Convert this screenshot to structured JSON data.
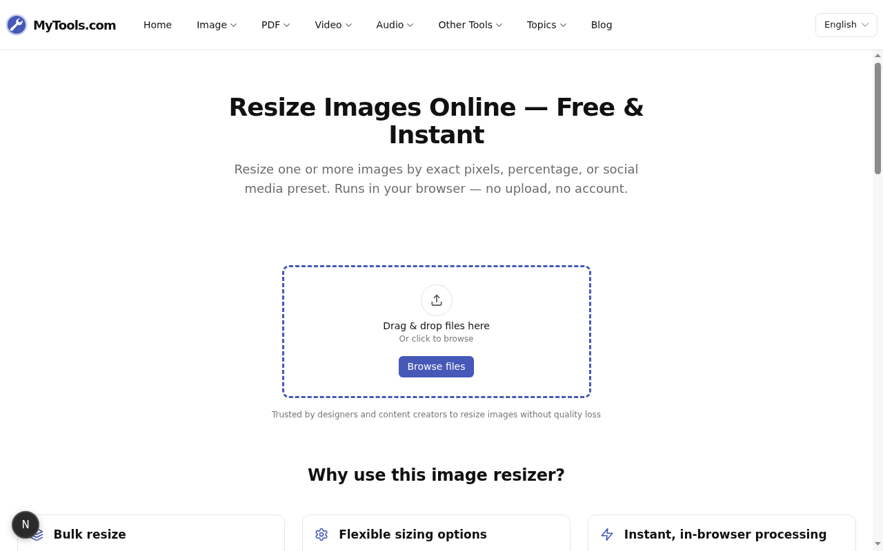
{
  "header": {
    "logo_text": "MyTools.com",
    "nav": [
      {
        "label": "Home",
        "dropdown": false
      },
      {
        "label": "Image",
        "dropdown": true
      },
      {
        "label": "PDF",
        "dropdown": true
      },
      {
        "label": "Video",
        "dropdown": true
      },
      {
        "label": "Audio",
        "dropdown": true
      },
      {
        "label": "Other Tools",
        "dropdown": true
      },
      {
        "label": "Topics",
        "dropdown": true
      },
      {
        "label": "Blog",
        "dropdown": false
      }
    ],
    "language": "English"
  },
  "hero": {
    "title": "Resize Images Online — Free & Instant",
    "subtitle": "Resize one or more images by exact pixels, percentage, or social media preset. Runs in your browser — no upload, no account."
  },
  "dropzone": {
    "title": "Drag & drop files here",
    "hint": "Or click to browse",
    "button": "Browse files",
    "note": "Trusted by designers and content creators to resize images without quality loss"
  },
  "features": {
    "heading": "Why use this image resizer?",
    "cards": [
      {
        "kind": "layers",
        "title": "Bulk resize"
      },
      {
        "kind": "gear",
        "title": "Flexible sizing options"
      },
      {
        "kind": "bolt",
        "title": "Instant, in-browser processing"
      }
    ]
  },
  "dev_badge": "N"
}
